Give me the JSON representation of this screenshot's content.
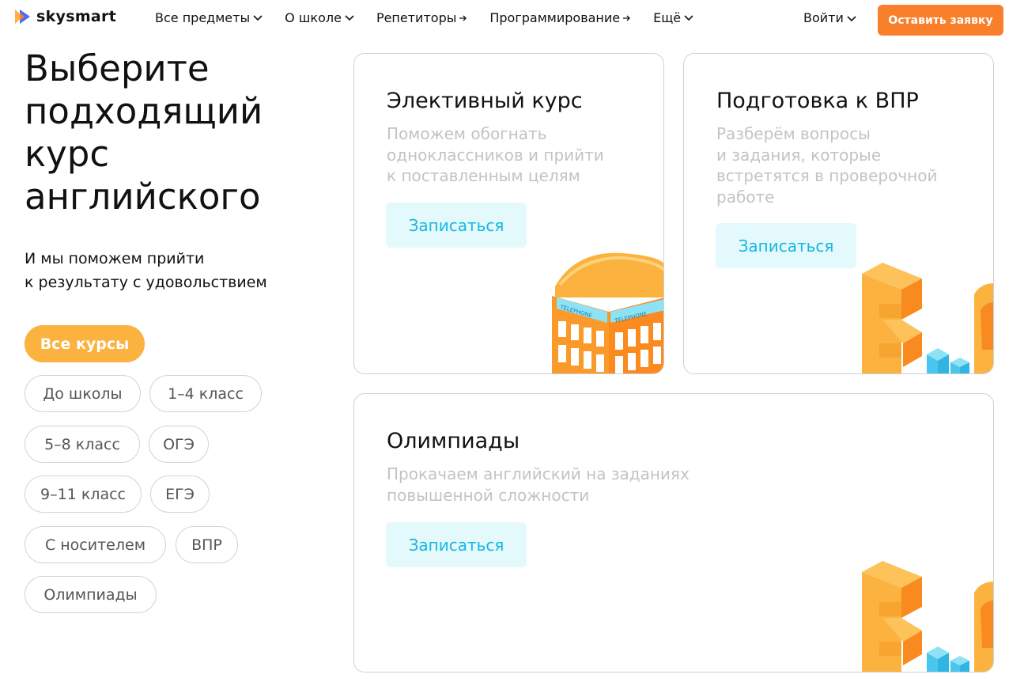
{
  "header": {
    "logo_text": "skysmart",
    "nav": [
      {
        "label": "Все предметы",
        "icon": "chevron-down-icon"
      },
      {
        "label": "О школе",
        "icon": "chevron-down-icon"
      },
      {
        "label": "Репетиторы",
        "icon": "arrow-right-icon"
      },
      {
        "label": "Программирование",
        "icon": "arrow-right-icon"
      },
      {
        "label": "Ещё",
        "icon": "chevron-down-icon"
      }
    ],
    "login_label": "Войти",
    "cta_label": "Оставить заявку"
  },
  "hero": {
    "title": "Выберите подходящий курс английского",
    "subtitle_line1": "И мы поможем прийти",
    "subtitle_line2": "к результату с удовольствием"
  },
  "filters": [
    {
      "label": "Все курсы",
      "active": true
    },
    {
      "label": "До школы",
      "active": false
    },
    {
      "label": "1–4 класс",
      "active": false
    },
    {
      "label": "5–8 класс",
      "active": false
    },
    {
      "label": "ОГЭ",
      "active": false
    },
    {
      "label": "9–11 класс",
      "active": false
    },
    {
      "label": "ЕГЭ",
      "active": false
    },
    {
      "label": "С носителем",
      "active": false
    },
    {
      "label": "ВПР",
      "active": false
    },
    {
      "label": "Олимпиады",
      "active": false
    }
  ],
  "cards": [
    {
      "title": "Элективный курс",
      "desc": [
        "Поможем обогнать",
        "одноклассников и прийти",
        "к поставленным целям"
      ],
      "button": "Записаться",
      "illustration_sign": "TELEPHONE"
    },
    {
      "title": "Подготовка к ВПР",
      "desc": [
        "Разберём вопросы",
        "и задания, которые",
        "встретятся в проверочной",
        "работе"
      ],
      "button": "Записаться"
    },
    {
      "title": "Олимпиады",
      "desc": [
        "Прокачаем английский на заданиях",
        "повышенной сложности"
      ],
      "button": "Записаться"
    }
  ],
  "colors": {
    "cta": "#f97f2a",
    "active_chip": "#fbb23f",
    "card_button_bg": "#e4f9fc",
    "card_button_text": "#14b8e2"
  }
}
